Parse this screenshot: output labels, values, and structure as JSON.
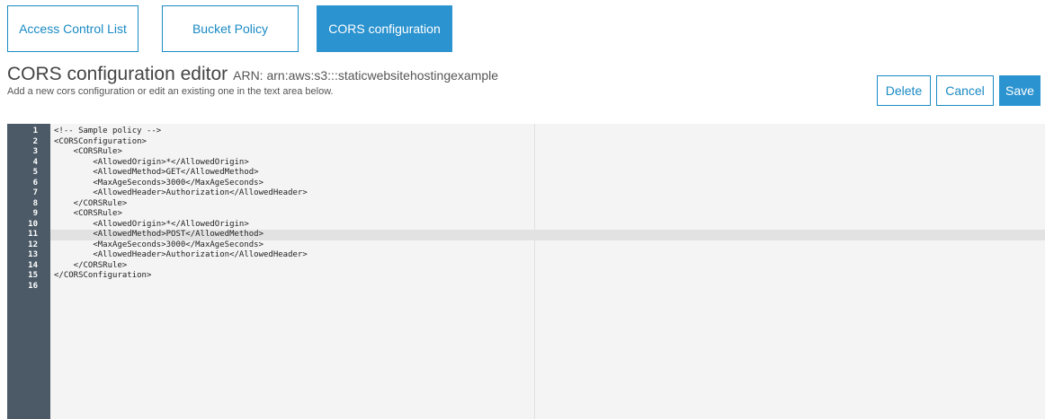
{
  "tabs": [
    {
      "label": "Access Control List",
      "active": false
    },
    {
      "label": "Bucket Policy",
      "active": false
    },
    {
      "label": "CORS configuration",
      "active": true
    }
  ],
  "header": {
    "title": "CORS configuration editor",
    "arn": "ARN: arn:aws:s3:::staticwebsitehostingexample",
    "subtitle": "Add a new cors configuration or edit an existing one in the text area below."
  },
  "actions": {
    "delete_label": "Delete",
    "cancel_label": "Cancel",
    "save_label": "Save"
  },
  "editor": {
    "active_line": 11,
    "lines": [
      {
        "num": "1",
        "text": "<!-- Sample policy -->"
      },
      {
        "num": "2",
        "text": "<CORSConfiguration>"
      },
      {
        "num": "3",
        "text": "    <CORSRule>"
      },
      {
        "num": "4",
        "text": "        <AllowedOrigin>*</AllowedOrigin>"
      },
      {
        "num": "5",
        "text": "        <AllowedMethod>GET</AllowedMethod>"
      },
      {
        "num": "6",
        "text": "        <MaxAgeSeconds>3000</MaxAgeSeconds>"
      },
      {
        "num": "7",
        "text": "        <AllowedHeader>Authorization</AllowedHeader>"
      },
      {
        "num": "8",
        "text": "    </CORSRule>"
      },
      {
        "num": "9",
        "text": "    <CORSRule>"
      },
      {
        "num": "10",
        "text": "        <AllowedOrigin>*</AllowedOrigin>"
      },
      {
        "num": "11",
        "text": "        <AllowedMethod>POST</AllowedMethod>"
      },
      {
        "num": "12",
        "text": "        <MaxAgeSeconds>3000</MaxAgeSeconds>"
      },
      {
        "num": "13",
        "text": "        <AllowedHeader>Authorization</AllowedHeader>"
      },
      {
        "num": "14",
        "text": "    </CORSRule>"
      },
      {
        "num": "15",
        "text": "</CORSConfiguration>"
      },
      {
        "num": "16",
        "text": ""
      }
    ]
  },
  "colors": {
    "accent": "#2b93cf",
    "gutter": "#4b5a66",
    "editor_bg": "#f4f4f4",
    "active_line": "#e2e2e2"
  }
}
